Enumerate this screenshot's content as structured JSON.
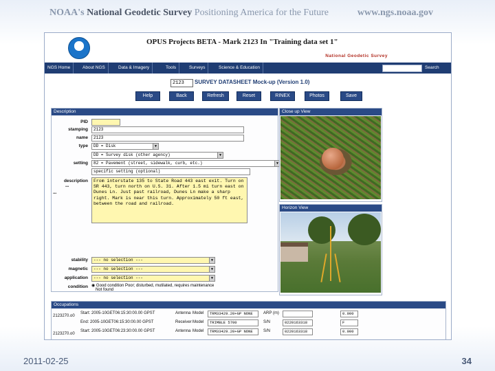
{
  "slide": {
    "banner_noaa": "NOAA's",
    "banner_ngs": "National Geodetic Survey",
    "banner_tagline": "Positioning America for the Future",
    "banner_url": "www.ngs.noaa.gov",
    "footer_date": "2011-02-25",
    "footer_page": "34"
  },
  "app": {
    "title": "OPUS Projects BETA - Mark 2123 In \"Training data set 1\"",
    "org": "National Geodetic Survey"
  },
  "nav": {
    "items": [
      "NGS Home",
      "About NGS",
      "Data & Imagery",
      "Tools",
      "Surveys",
      "Science & Education"
    ],
    "search_label": "Search"
  },
  "datasheet": {
    "station_value": "2123",
    "title": "SURVEY DATASHEET Mock-up (Version 1.0)"
  },
  "buttons": [
    "Help",
    "Back",
    "Refresh",
    "Reset",
    "RINEX",
    "Photos",
    "Save"
  ],
  "description_panel": {
    "header": "Description",
    "fields": {
      "pid_label": "PID",
      "pid_value": "",
      "stamping_label": "stamping",
      "stamping_value": "2123",
      "name_label": "name",
      "name_value": "2123",
      "type_label": "type",
      "type_value": "DD = Disk",
      "setting_label": "setting",
      "setting_value_1": "DD = Survey disk (other agency)",
      "setting_value_2": "82 = Pavement (street, sidewalk, curb, etc.)",
      "specific_label": "specific setting (optional)",
      "description_label": "description",
      "description_text": "From interstate 135 to State Road 443 east exit. Turn on SR 443, turn north on U.S. 31. After 1.5 mi turn east on Dunes Ln. Just past railroad, Dunes Ln make a sharp right. Mark is near this turn. Approximately 50 ft east, between the road and railroad.",
      "stability_label": "stability",
      "stability_value": "--- no selection ---",
      "magnetic_label": "magnetic",
      "magnetic_value": "--- no selection ---",
      "application_label": "application",
      "application_value": "--- no selection ---",
      "condition_label": "condition",
      "condition_text": "Good condition  Poor; disturbed, mutilated, requires maintenance",
      "condition_text_2": "Not found"
    }
  },
  "photos": {
    "closeup_header": "Close up View",
    "horizon_header": "Horizon View"
  },
  "occupations": {
    "header": "Occupations",
    "rows": [
      {
        "id": "2123270.o0",
        "start": "Start: 2005-10GET06:15:30:00.00 GPST",
        "antenna_label": "Antenna",
        "model_label": "Model",
        "model": "TRM33429.20+GP NONE",
        "sn_label": "ARP (m)",
        "sn": "",
        "unit": "0.000"
      },
      {
        "id": "2123270.o0",
        "start": "End: 2005-10GET06:15:30:00.00 GPST",
        "antenna_label": "Receiver",
        "model_label": "Model",
        "model": "TRIMBLE 5700",
        "sn_label": "S/N",
        "sn": "0220163318",
        "unit": "F"
      },
      {
        "id": "2123270.o0",
        "start": "Start: 2005-10GET06:23:30:00.00 GPST",
        "antenna_label": "Antenna",
        "model_label": "Model",
        "model": "TRM33429.20+GP NONE",
        "sn_label": "S/N",
        "sn": "0220163318",
        "unit": "0.000"
      }
    ]
  },
  "colors": {
    "navbar": "#1f3d73",
    "button": "#2a4a86",
    "required_field": "#fff7b0",
    "org_red": "#b02a1e"
  }
}
